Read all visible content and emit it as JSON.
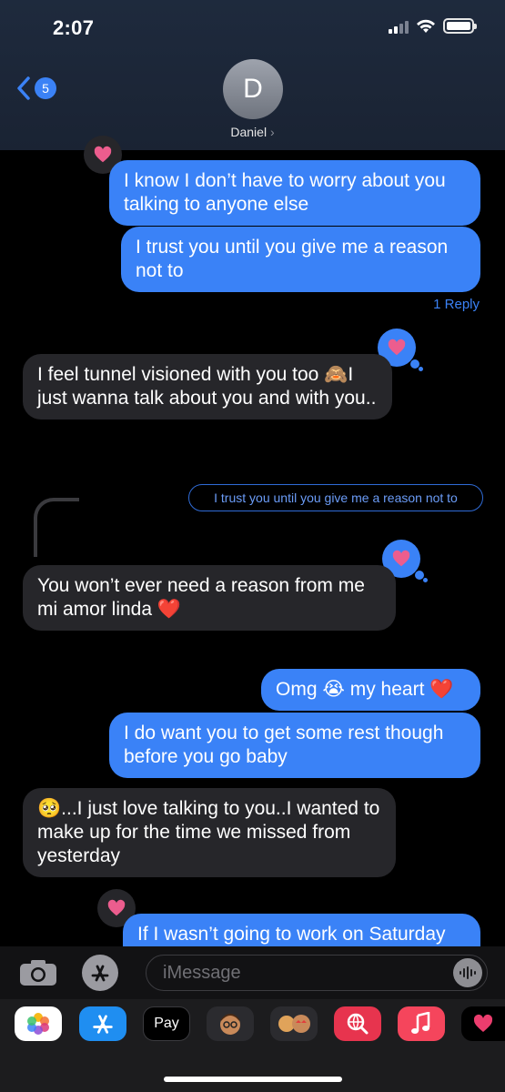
{
  "status_bar": {
    "time": "2:07"
  },
  "header": {
    "back_count": "5",
    "avatar_initial": "D",
    "contact_name": "Daniel",
    "chevron": "›"
  },
  "messages": [
    {
      "kind": "out",
      "text": "I know I don’t have to worry about you talking to anyone else"
    },
    {
      "kind": "out",
      "text": "I trust you until you give me a reason not to"
    },
    {
      "kind": "link",
      "text": "1 Reply"
    },
    {
      "kind": "in",
      "text": "I feel tunnel visioned with you too 🙈I just wanna talk about you and with you.."
    },
    {
      "kind": "reply_quote",
      "text": "I trust you until you give me a reason not to"
    },
    {
      "kind": "in",
      "text": "You won’t ever need a reason from me mi amor linda ❤️"
    },
    {
      "kind": "out",
      "text": "Omg 😭 my heart ❤️"
    },
    {
      "kind": "out",
      "text": "I do want you to get some rest though before you go baby"
    },
    {
      "kind": "in",
      "text": "🥺...I just love talking to you..I wanted to make up for the time we missed from yesterday"
    },
    {
      "kind": "out",
      "text": "If I wasn’t going to work on Saturday"
    }
  ],
  "composer": {
    "placeholder": "iMessage"
  },
  "apps": [
    {
      "name": "Photos"
    },
    {
      "name": "App Store"
    },
    {
      "name": "Apple Pay",
      "label": "Pay"
    },
    {
      "name": "Memoji"
    },
    {
      "name": "Memoji Stickers"
    },
    {
      "name": "Search"
    },
    {
      "name": "Music"
    },
    {
      "name": "Digital Touch"
    }
  ],
  "colors": {
    "outgoing": "#3a82f7",
    "incoming": "#26262a",
    "heart": "#ec5d8e",
    "background": "#000000"
  }
}
